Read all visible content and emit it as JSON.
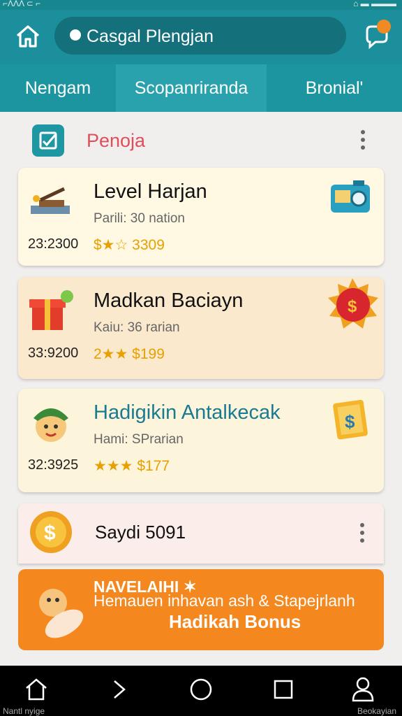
{
  "status_bar": {
    "left_text": "⌐ΛΛΛ ⊂ ⌐",
    "right_text": "⌂ ▬ ▬▬▬"
  },
  "header": {
    "search_text": "Casgal Plengjan"
  },
  "tabs": [
    {
      "label": "Nengam"
    },
    {
      "label": "Scopanriranda"
    },
    {
      "label": "Bronial'"
    }
  ],
  "section": {
    "title": "Penoja"
  },
  "cards": [
    {
      "title": "Level Harjan",
      "subtitle": "Parili: 30 nation",
      "meta": "23:2300",
      "price": "$★☆ 3309",
      "bg": "#fff8e3"
    },
    {
      "title": "Madkan Baciayn",
      "subtitle": "Kaiu: 36 rarian",
      "meta": "33:9200",
      "price": "2★★ $199",
      "bg": "#fbe9cd"
    },
    {
      "title": "Hadigikin Antalkecak",
      "subtitle": "Hami: SPrarian",
      "meta": "32:3925",
      "price": "★★★ $177",
      "bg": "#fcf5dc"
    },
    {
      "title": "Saydi 5091",
      "bg": "#fbeeea"
    }
  ],
  "promo": {
    "line1": "NAVELAIHI ✶",
    "line2": "Hemauen inhavan ash & Stapejrlanh",
    "line3": "Hadikah Bonus"
  },
  "bottom_nav": {
    "left_label": "Nantl nyige",
    "right_label": "Beokayian"
  },
  "colors": {
    "header": "#1b8f9b",
    "tabs": "#1d95a1",
    "accent_red": "#e04d5b",
    "promo": "#f5871f",
    "gold": "#e8a000"
  }
}
